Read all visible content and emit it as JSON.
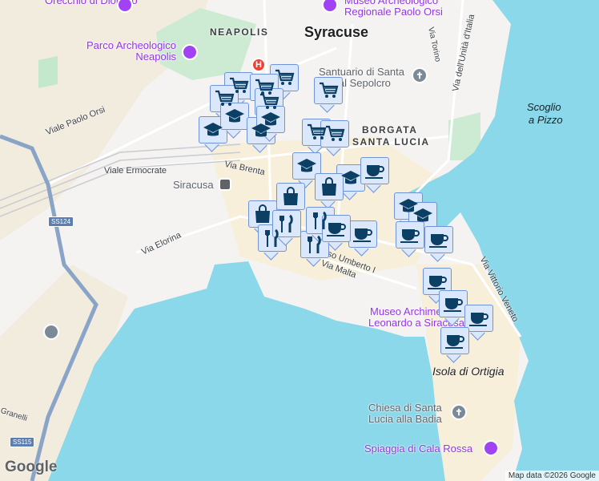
{
  "map": {
    "labels": {
      "orecchio": "Orecchio di Dionisio",
      "museo_orsi_1": "Museo Archeologico",
      "museo_orsi_2": "Regionale Paolo Orsi",
      "neapolis": "NEAPOLIS",
      "syracuse": "Syracuse",
      "parco_1": "Parco Archeologico",
      "parco_2": "Neapolis",
      "santuario_1": "Santuario di Santa",
      "santuario_2": "a al Sepolcro",
      "via_torino": "Via Torino",
      "via_unita": "Via dell'Unità d'Italia",
      "scoglio_1": "Scoglio",
      "scoglio_2": "a Pizzo",
      "viale_paolo_orsi": "Viale Paolo Orsi",
      "borgata_1": "BORGATA",
      "borgata_2": "SANTA LUCIA",
      "viale_ermocrate": "Viale Ermocrate",
      "via_brenta": "Via Brenta",
      "siracusa": "Siracusa",
      "via_elorina": "Via Elorina",
      "corso_umberto": "Corso Umberto I",
      "via_malta": "Via Malta",
      "via_vittorio": "Via Vittorio Veneto",
      "museo_arch_1": "Museo Archimede",
      "museo_arch_2": "Leonardo a Siracusa",
      "ortigia": "Isola di Ortigia",
      "chiesa_1": "Chiesa di Santa",
      "chiesa_2": "Lucia alla Badia",
      "spiaggia": "Spiaggia di Cala Rossa",
      "granelli": "Granelli",
      "ss124": "SS124",
      "ss115": "SS115",
      "hospital": "H"
    },
    "markers": [
      "cart",
      "cart",
      "cart",
      "cart",
      "cart",
      "cart",
      "cart",
      "cart",
      "cap",
      "cap",
      "cap",
      "cap",
      "cap",
      "cap",
      "cap",
      "cap",
      "bag",
      "bag",
      "bag",
      "fork",
      "fork",
      "fork",
      "fork",
      "coffee",
      "coffee",
      "coffee",
      "coffee",
      "coffee",
      "coffee",
      "coffee",
      "coffee",
      "coffee"
    ],
    "colors": {
      "water": "#8ad8ea",
      "land": "#f4f3f2",
      "urban": "#f7efd9",
      "park": "#bfe8c8",
      "marker_fill": "#dbe7fb",
      "icon": "#0b3f63",
      "poi": "#9334e6"
    },
    "logo": "Google",
    "attribution": "Map data ©2026 Google"
  }
}
